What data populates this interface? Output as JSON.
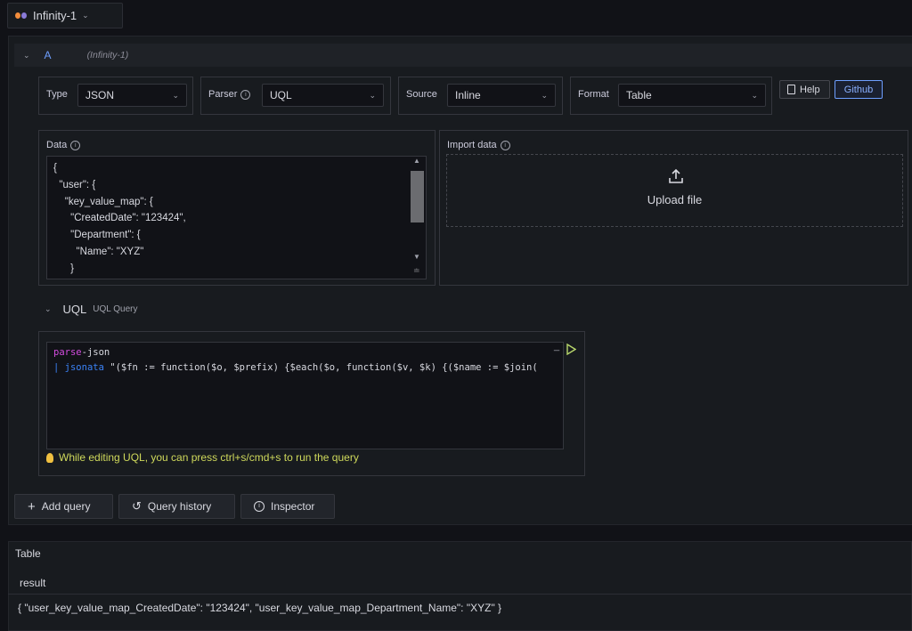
{
  "datasource": {
    "name": "Infinity-1"
  },
  "query": {
    "letter": "A",
    "datasource_label": "(Infinity-1)"
  },
  "config": {
    "type": {
      "label": "Type",
      "value": "JSON"
    },
    "parser": {
      "label": "Parser",
      "value": "UQL"
    },
    "source": {
      "label": "Source",
      "value": "Inline"
    },
    "format": {
      "label": "Format",
      "value": "Table"
    },
    "help_label": "Help",
    "github_label": "Github"
  },
  "data_panel": {
    "label": "Data",
    "lines": [
      "{",
      "  \"user\": {",
      "    \"key_value_map\": {",
      "      \"CreatedDate\": \"123424\",",
      "      \"Department\": {",
      "        \"Name\": \"XYZ\"",
      "      }"
    ]
  },
  "import_panel": {
    "label": "Import data",
    "upload_label": "Upload file"
  },
  "uql": {
    "title": "UQL",
    "subtitle": "UQL Query",
    "line1_keyword": "parse",
    "line1_rest": "-json",
    "line2_pipe": "|",
    "line2_keyword": "jsonata",
    "line2_rest": " \"($fn := function($o, $prefix) {$each($o, function($v, $k) {($name := $join(",
    "hint": "While editing UQL, you can press ctrl+s/cmd+s to run the query"
  },
  "actions": {
    "add_query": "Add query",
    "query_history": "Query history",
    "inspector": "Inspector"
  },
  "table": {
    "title": "Table",
    "column": "result",
    "row": "{ \"user_key_value_map_CreatedDate\": \"123424\", \"user_key_value_map_Department_Name\": \"XYZ\" }"
  }
}
